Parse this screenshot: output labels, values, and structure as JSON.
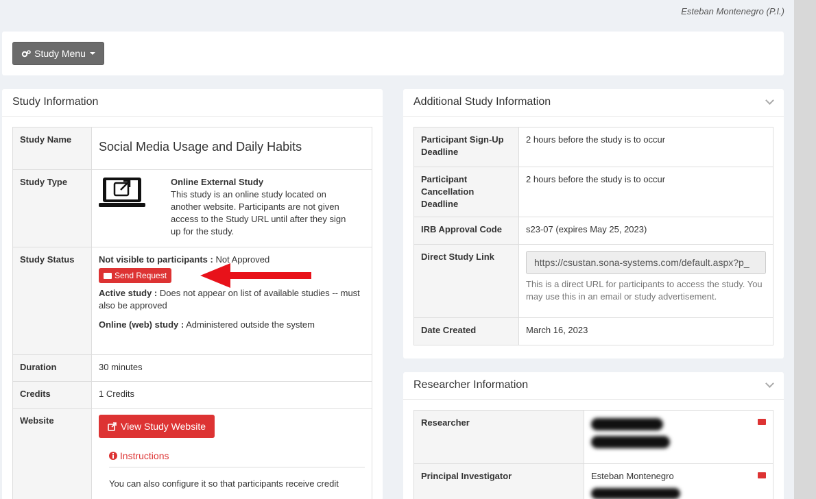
{
  "top_user": "Esteban Montenegro (P.I.)",
  "study_menu": {
    "label": "Study Menu"
  },
  "study_info": {
    "title": "Study Information",
    "study_name_label": "Study Name",
    "study_name": "Social Media Usage and Daily Habits",
    "study_type_label": "Study Type",
    "study_type_title": "Online External Study",
    "study_type_desc": "This study is an online study located on another website. Participants are not given access to the Study URL until after they sign up for the study.",
    "status_label": "Study Status",
    "visible_label": "Not visible to participants :",
    "visible_value": " Not Approved",
    "send_request": "Send Request",
    "active_label": "Active study :",
    "active_value": " Does not appear on list of available studies -- must also be approved",
    "online_label": "Online (web) study :",
    "online_value": " Administered outside the system",
    "duration_label": "Duration",
    "duration": "30 minutes",
    "credits_label": "Credits",
    "credits": "1 Credits",
    "website_label": "Website",
    "view_website": "View Study Website",
    "instructions": "Instructions",
    "configure_text": "You can also configure it so that participants receive credit"
  },
  "additional": {
    "title": "Additional Study Information",
    "signup_label": "Participant Sign-Up Deadline",
    "signup": "2 hours before the study is to occur",
    "cancel_label": "Participant Cancellation Deadline",
    "cancel": "2 hours before the study is to occur",
    "irb_label": "IRB Approval Code",
    "irb": "s23-07 (expires May 25, 2023)",
    "link_label": "Direct Study Link",
    "link": "https://csustan.sona-systems.com/default.aspx?p_",
    "link_help": "This is a direct URL for participants to access the study. You may use this in an email or study advertisement.",
    "created_label": "Date Created",
    "created": "March 16, 2023"
  },
  "researcher": {
    "title": "Researcher Information",
    "researcher_label": "Researcher",
    "pi_label": "Principal Investigator",
    "pi_name": "Esteban Montenegro"
  },
  "colors": {
    "accent": "#dd3333",
    "menu_button": "#6b6b6b"
  }
}
